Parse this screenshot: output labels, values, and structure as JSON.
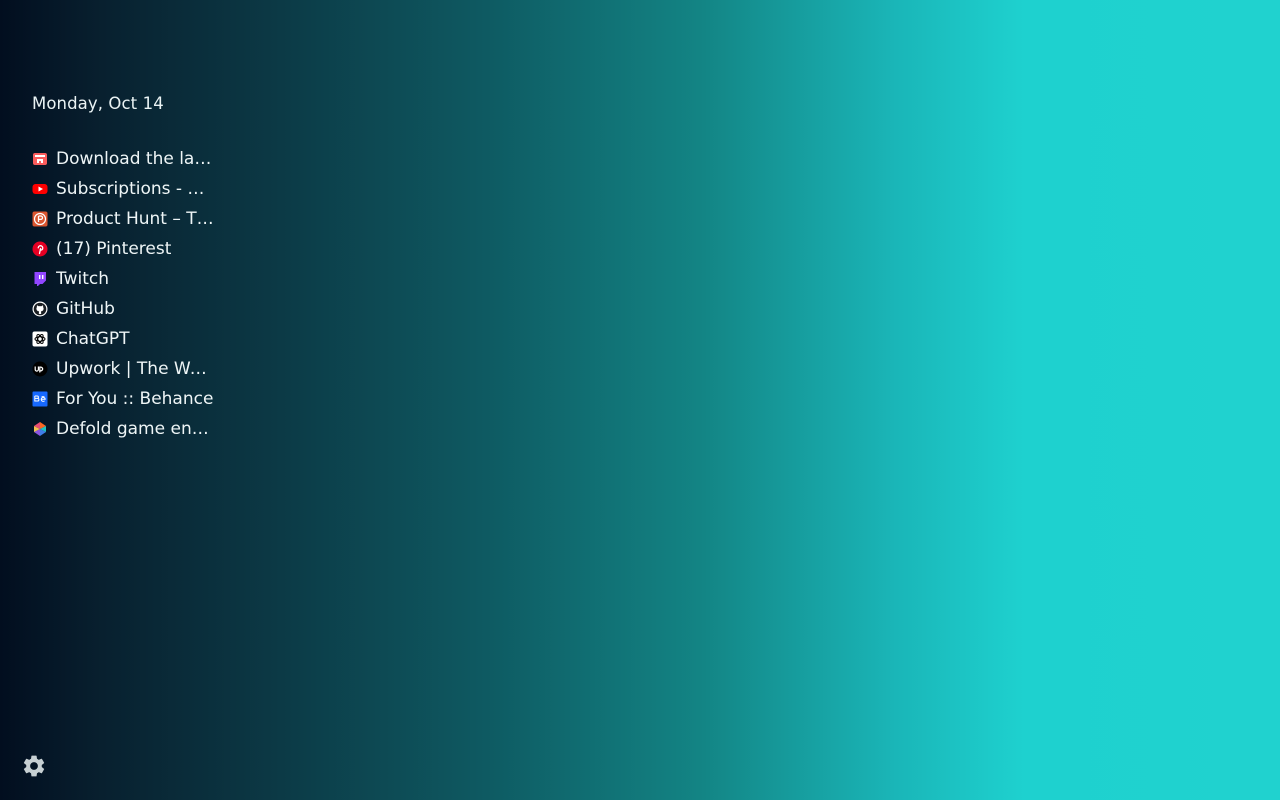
{
  "date": "Monday, Oct 14",
  "bookmarks": [
    {
      "label": "Download the latest version",
      "display": "Download the lat…",
      "icon": "itch-icon",
      "color": "#fa5c5c"
    },
    {
      "label": "Subscriptions - YouTube",
      "display": "Subscriptions - …",
      "icon": "youtube-icon",
      "color": "#ff0000"
    },
    {
      "label": "Product Hunt – The best new products",
      "display": "Product Hunt – T…",
      "icon": "producthunt-icon",
      "color": "#da552f"
    },
    {
      "label": "(17) Pinterest",
      "display": "(17) Pinterest",
      "icon": "pinterest-icon",
      "color": "#e60023"
    },
    {
      "label": "Twitch",
      "display": "Twitch",
      "icon": "twitch-icon",
      "color": "#9146ff"
    },
    {
      "label": "GitHub",
      "display": "GitHub",
      "icon": "github-icon",
      "color": "#ffffff"
    },
    {
      "label": "ChatGPT",
      "display": "ChatGPT",
      "icon": "chatgpt-icon",
      "color": "#ffffff"
    },
    {
      "label": "Upwork | The World's Work Marketplace",
      "display": "Upwork | The Wor…",
      "icon": "upwork-icon",
      "color": "#000000"
    },
    {
      "label": "For You :: Behance",
      "display": "For You :: Behance",
      "icon": "behance-icon",
      "color": "#1769ff"
    },
    {
      "label": "Defold game engine",
      "display": "Defold game engi…",
      "icon": "defold-icon",
      "color": "#fd6623"
    }
  ],
  "settings": {
    "icon": "gear-icon"
  }
}
